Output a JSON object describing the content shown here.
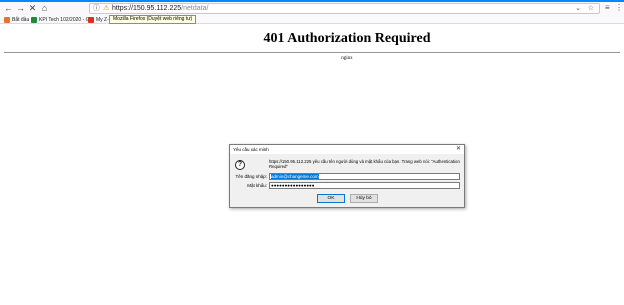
{
  "browser": {
    "url": {
      "prefix": "https://150.95.112.225",
      "path": "/netdata/"
    },
    "bookmarks": [
      {
        "label": "Bắt đầu",
        "color": "#e8732d"
      },
      {
        "label": "KPI Tech 102/2020 - G...",
        "color": "#1e8c3a"
      },
      {
        "label": "My Z-m",
        "color": "#d93025"
      }
    ],
    "tooltip": "Mozilla Firefox (Duyệt web riêng tư)"
  },
  "page": {
    "title": "401 Authorization Required",
    "server": "nginx"
  },
  "dialog": {
    "title": "Yêu cầu xác minh",
    "message": "https://150.95.112.225 yêu cầu tên người dùng và mật khẩu của bạn. Trang web nói: \"Authentication Required\"",
    "username_label": "Tên đăng nhập:",
    "username_value": "admin@changeme.com",
    "password_label": "Mật khẩu:",
    "password_mask": "●●●●●●●●●●●●●●●●",
    "ok_label": "OK",
    "cancel_label": "Hủy bỏ"
  },
  "colors": {
    "accent": "#0a84ff",
    "selection": "#0078d7"
  }
}
